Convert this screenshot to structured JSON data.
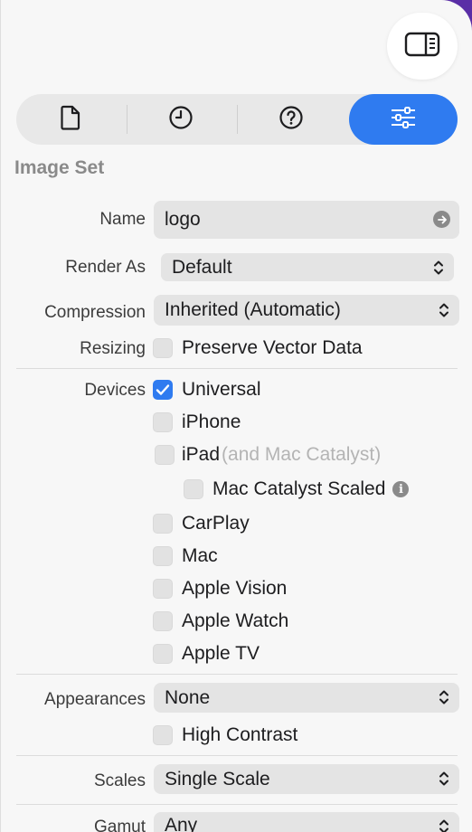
{
  "colors": {
    "accent": "#2f7bf0",
    "corner": "#5a2ea6"
  },
  "toolbar": {
    "sidebar_toggle_icon": "sidebar-right-icon",
    "tabs": [
      {
        "icon": "document-icon",
        "active": false
      },
      {
        "icon": "clock-icon",
        "active": false
      },
      {
        "icon": "help-icon",
        "active": false
      },
      {
        "icon": "sliders-icon",
        "active": true
      }
    ]
  },
  "inspector": {
    "section_title": "Image Set",
    "name": {
      "label": "Name",
      "value": "logo"
    },
    "render_as": {
      "label": "Render As",
      "value": "Default"
    },
    "compression": {
      "label": "Compression",
      "value": "Inherited (Automatic)"
    },
    "resizing": {
      "label": "Resizing",
      "option": "Preserve Vector Data",
      "checked": false
    },
    "devices": {
      "label": "Devices",
      "options": [
        {
          "label": "Universal",
          "checked": true
        },
        {
          "label": "iPhone",
          "checked": false
        },
        {
          "label": "iPad",
          "suffix": "(and Mac Catalyst)",
          "checked": false
        },
        {
          "label": "Mac Catalyst Scaled",
          "checked": false
        },
        {
          "label": "CarPlay",
          "checked": false
        },
        {
          "label": "Mac",
          "checked": false
        },
        {
          "label": "Apple Vision",
          "checked": false
        },
        {
          "label": "Apple Watch",
          "checked": false
        },
        {
          "label": "Apple TV",
          "checked": false
        }
      ]
    },
    "appearances": {
      "label": "Appearances",
      "value": "None",
      "option": "High Contrast",
      "checked": false
    },
    "scales": {
      "label": "Scales",
      "value": "Single Scale"
    },
    "gamut": {
      "label": "Gamut",
      "value": "Any"
    }
  }
}
